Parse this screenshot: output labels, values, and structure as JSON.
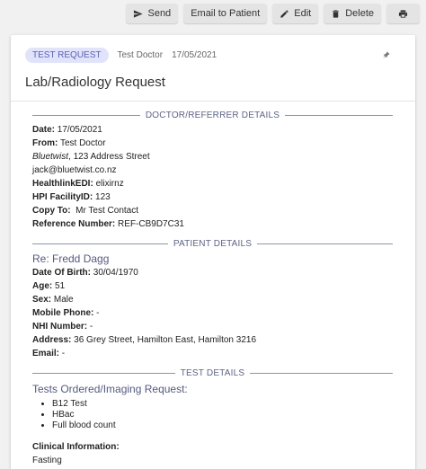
{
  "toolbar": {
    "send_label": "Send",
    "email_label": "Email to Patient",
    "edit_label": "Edit",
    "delete_label": "Delete"
  },
  "header": {
    "badge": "TEST REQUEST",
    "author": "Test Doctor",
    "date": "17/05/2021",
    "title": "Lab/Radiology Request"
  },
  "doctor": {
    "section_title": "DOCTOR/REFERRER DETAILS",
    "date_label": "Date:",
    "date_value": "17/05/2021",
    "from_label": "From:",
    "from_value": "Test Doctor",
    "practice_name": "Bluetwist",
    "practice_address": ", 123 Address Street",
    "email": "jack@bluetwist.co.nz",
    "healthlink_label": "HealthlinkEDI:",
    "healthlink_value": "elixirnz",
    "hpi_label": "HPI FacilityID:",
    "hpi_value": "123",
    "copyto_label": "Copy To:",
    "copyto_value": "Mr Test Contact",
    "ref_label": "Reference Number:",
    "ref_value": "REF-CB9D7C31"
  },
  "patient": {
    "section_title": "PATIENT DETAILS",
    "re_line": "Re: Fredd Dagg",
    "dob_label": "Date Of Birth:",
    "dob_value": "30/04/1970",
    "age_label": "Age:",
    "age_value": "51",
    "sex_label": "Sex:",
    "sex_value": "Male",
    "mobile_label": "Mobile Phone:",
    "mobile_value": "-",
    "nhi_label": "NHI Number:",
    "nhi_value": "-",
    "address_label": "Address:",
    "address_value": "36 Grey Street, Hamilton East, Hamilton 3216",
    "email_label": "Email:",
    "email_value": "-"
  },
  "tests": {
    "section_title": "TEST DETAILS",
    "ordered_heading": "Tests Ordered/Imaging Request:",
    "items": [
      "B12 Test",
      "HBac",
      "Full blood count"
    ],
    "clinical_label": "Clinical Information:",
    "clinical_value": "Fasting"
  }
}
